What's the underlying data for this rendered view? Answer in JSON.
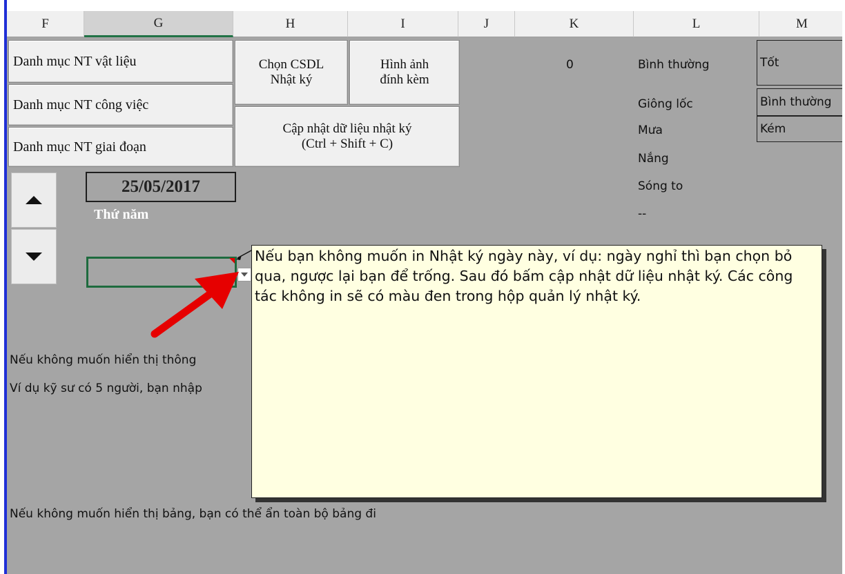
{
  "columns": [
    "F",
    "G",
    "H",
    "I",
    "J",
    "K",
    "L",
    "M"
  ],
  "buttons": {
    "danh_muc_vat_lieu": "Danh mục NT vật liệu",
    "danh_muc_cong_viec": "Danh mục NT công việc",
    "danh_muc_giai_doan": "Danh mục NT giai đoạn",
    "chon_csdl_line1": "Chọn CSDL",
    "chon_csdl_line2": "Nhật ký",
    "hinh_anh_line1": "Hình ảnh",
    "hinh_anh_line2": "đính kèm",
    "cap_nhat_line1": "Cập nhật dữ liệu nhật ký",
    "cap_nhat_line2": "(Ctrl + Shift + C)"
  },
  "cells": {
    "k_value": "0",
    "weather": [
      "Bình thường",
      "Giông lốc",
      "Mưa",
      "Nắng",
      "Sóng to",
      "--"
    ],
    "quality": [
      "Tốt",
      "Bình thường",
      "Kém"
    ],
    "date": "25/05/2017",
    "weekday": "Thứ năm",
    "note1": "Nếu không muốn hiển thị thông",
    "note2": "Ví dụ kỹ sư có 5 người, bạn nhập",
    "note3": "Nếu không muốn hiển thị bảng, bạn có thể ẩn toàn bộ bảng đi"
  },
  "tooltip": {
    "text": "Nếu bạn không muốn in Nhật ký ngày này, ví dụ: ngày nghỉ thì bạn chọn bỏ qua, ngược lại bạn để trống. Sau đó bấm cập nhật dữ liệu nhật ký. Các công tác không in sẽ có màu đen trong hộp quản lý nhật ký."
  },
  "icons": [
    "arrow-up-icon",
    "arrow-down-icon",
    "dropdown-arrow-icon",
    "red-arrow-icon"
  ],
  "colors": {
    "sheet_bg": "#a5a5a5",
    "tooltip_bg": "#ffffe1",
    "frame_accent": "#1f2fd6",
    "selection": "#217346",
    "annotation_arrow": "#e60000"
  }
}
